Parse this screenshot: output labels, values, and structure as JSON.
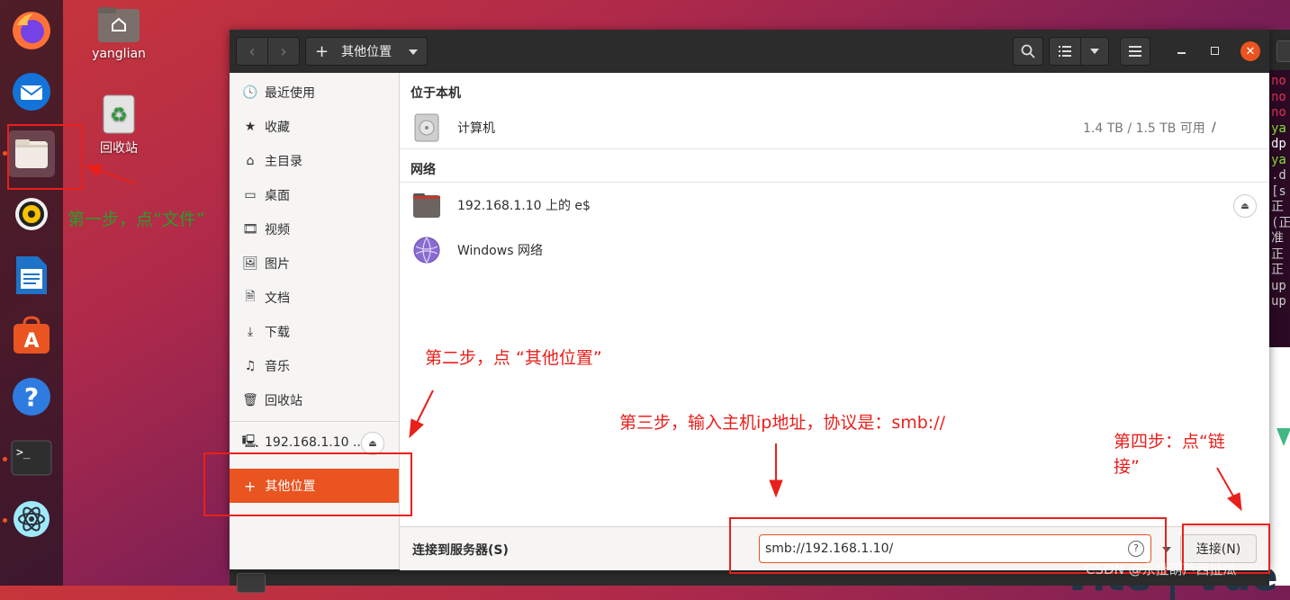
{
  "desktop": {
    "home_folder": "yanglian",
    "trash": "回收站"
  },
  "dock": {
    "apps": [
      "firefox-icon",
      "thunderbird-icon",
      "files-icon",
      "rhythmbox-icon",
      "writer-icon",
      "software-icon",
      "help-icon",
      "terminal-icon",
      "electron-icon"
    ]
  },
  "window": {
    "location": "其他位置",
    "sidebar": {
      "items": [
        {
          "icon": "clock-icon",
          "label": "最近使用"
        },
        {
          "icon": "star-icon",
          "label": "收藏"
        },
        {
          "icon": "home-icon",
          "label": "主目录"
        },
        {
          "icon": "desktop-icon",
          "label": "桌面"
        },
        {
          "icon": "video-icon",
          "label": "视频"
        },
        {
          "icon": "picture-icon",
          "label": "图片"
        },
        {
          "icon": "document-icon",
          "label": "文档"
        },
        {
          "icon": "download-icon",
          "label": "下载"
        },
        {
          "icon": "music-icon",
          "label": "音乐"
        },
        {
          "icon": "trash-icon",
          "label": "回收站"
        }
      ],
      "network_mount": "192.168.1.10 ...",
      "other_locations": "其他位置"
    },
    "main": {
      "on_this_computer": "位于本机",
      "computer": {
        "name": "计算机",
        "usage": "1.4 TB / 1.5 TB 可用",
        "path": "/"
      },
      "network": "网络",
      "share": "192.168.1.10 上的 e$",
      "windows_network": "Windows 网络"
    },
    "bottom": {
      "label": "连接到服务器(S)",
      "address": "smb://192.168.1.10/",
      "connect": "连接(N)"
    }
  },
  "annotations": {
    "step1": "第一步，点“文件”",
    "step2": "第二步，点 “其他位置”",
    "step3": "第三步，输入主机ip地址，协议是：smb://",
    "step4_line1": "第四步：点“链",
    "step4_line2": "接”"
  },
  "terminal_lines": [
    {
      "t": "no",
      "c": "#e0305a"
    },
    {
      "t": "no",
      "c": "#e0305a"
    },
    {
      "t": "no",
      "c": "#e0305a"
    },
    {
      "t": "ya",
      "c": "#8ae234"
    },
    {
      "t": "dp",
      "c": "#ffffff"
    },
    {
      "t": "ya",
      "c": "#8ae234"
    },
    {
      "t": ".d",
      "c": "#cccccc"
    },
    {
      "t": "[s",
      "c": "#cccccc"
    },
    {
      "t": "正",
      "c": "#cccccc"
    },
    {
      "t": "(正",
      "c": "#cccccc"
    },
    {
      "t": "准",
      "c": "#cccccc"
    },
    {
      "t": "正",
      "c": "#cccccc"
    },
    {
      "t": "正",
      "c": "#cccccc"
    },
    {
      "t": "up",
      "c": "#cccccc"
    },
    {
      "t": "up",
      "c": "#cccccc"
    }
  ],
  "watermark": "CSDN @东扯葫芦西扯瓜",
  "bg_text": "Vite | Vue",
  "colors": {
    "accent": "#e95420",
    "annotation": "#e8201c"
  }
}
